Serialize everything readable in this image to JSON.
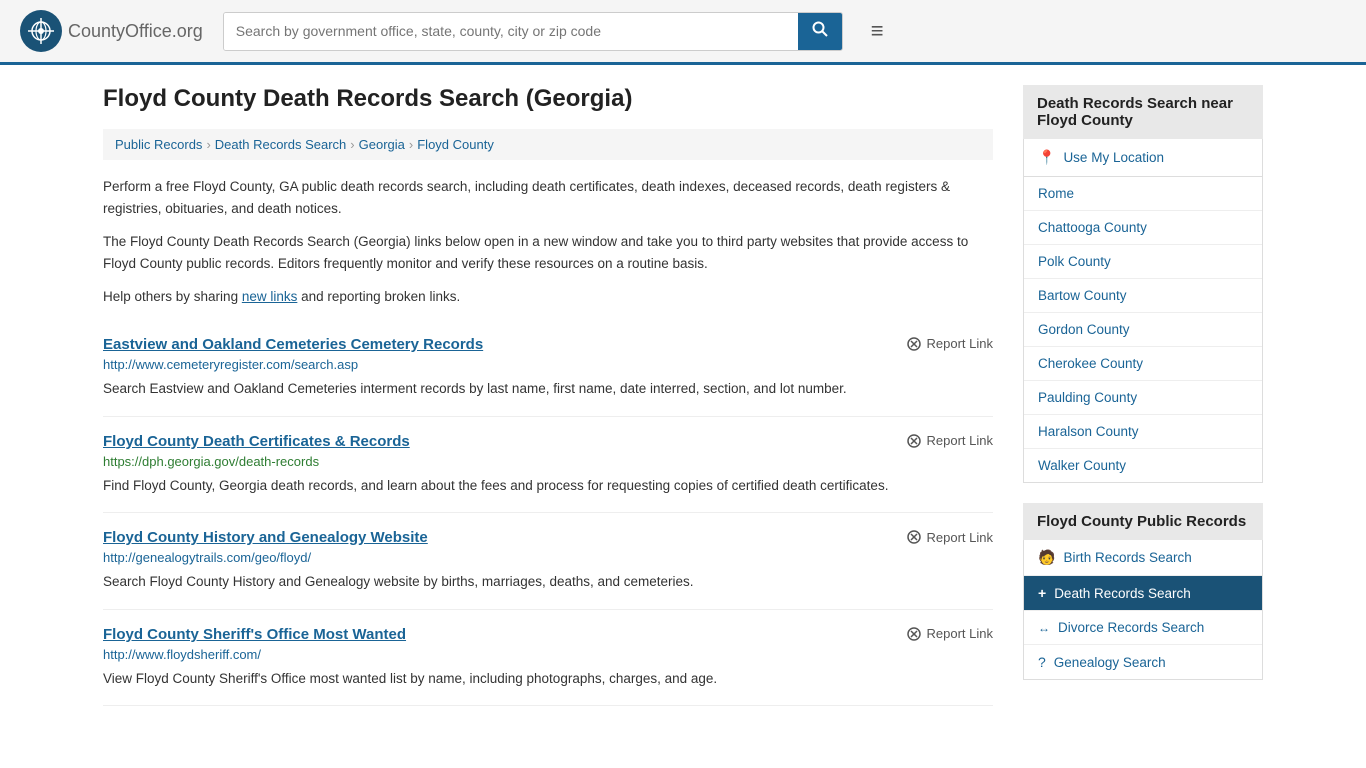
{
  "header": {
    "logo_text": "CountyOffice",
    "logo_suffix": ".org",
    "search_placeholder": "Search by government office, state, county, city or zip code",
    "search_value": ""
  },
  "page": {
    "title": "Floyd County Death Records Search (Georgia)",
    "breadcrumb": [
      {
        "label": "Public Records",
        "href": "#"
      },
      {
        "label": "Death Records Search",
        "href": "#"
      },
      {
        "label": "Georgia",
        "href": "#"
      },
      {
        "label": "Floyd County",
        "href": "#"
      }
    ],
    "desc1": "Perform a free Floyd County, GA public death records search, including death certificates, death indexes, deceased records, death registers & registries, obituaries, and death notices.",
    "desc2": "The Floyd County Death Records Search (Georgia) links below open in a new window and take you to third party websites that provide access to Floyd County public records. Editors frequently monitor and verify these resources on a routine basis.",
    "desc3_before": "Help others by sharing ",
    "desc3_link": "new links",
    "desc3_after": " and reporting broken links."
  },
  "results": [
    {
      "title": "Eastview and Oakland Cemeteries Cemetery Records",
      "url": "http://www.cemeteryregister.com/search.asp",
      "url_color": "blue",
      "desc": "Search Eastview and Oakland Cemeteries interment records by last name, first name, date interred, section, and lot number.",
      "report_label": "Report Link"
    },
    {
      "title": "Floyd County Death Certificates & Records",
      "url": "https://dph.georgia.gov/death-records",
      "url_color": "green",
      "desc": "Find Floyd County, Georgia death records, and learn about the fees and process for requesting copies of certified death certificates.",
      "report_label": "Report Link"
    },
    {
      "title": "Floyd County History and Genealogy Website",
      "url": "http://genealogytrails.com/geo/floyd/",
      "url_color": "blue",
      "desc": "Search Floyd County History and Genealogy website by births, marriages, deaths, and cemeteries.",
      "report_label": "Report Link"
    },
    {
      "title": "Floyd County Sheriff's Office Most Wanted",
      "url": "http://www.floydsheriff.com/",
      "url_color": "blue",
      "desc": "View Floyd County Sheriff's Office most wanted list by name, including photographs, charges, and age.",
      "report_label": "Report Link"
    }
  ],
  "sidebar": {
    "nearby_header": "Death Records Search near Floyd County",
    "use_location": "Use My Location",
    "nearby_items": [
      {
        "label": "Rome",
        "href": "#"
      },
      {
        "label": "Chattooga County",
        "href": "#"
      },
      {
        "label": "Polk County",
        "href": "#"
      },
      {
        "label": "Bartow County",
        "href": "#"
      },
      {
        "label": "Gordon County",
        "href": "#"
      },
      {
        "label": "Cherokee County",
        "href": "#"
      },
      {
        "label": "Paulding County",
        "href": "#"
      },
      {
        "label": "Haralson County",
        "href": "#"
      },
      {
        "label": "Walker County",
        "href": "#"
      }
    ],
    "public_records_header": "Floyd County Public Records",
    "public_records_items": [
      {
        "label": "Birth Records Search",
        "icon": "person",
        "active": false
      },
      {
        "label": "Death Records Search",
        "icon": "plus",
        "active": true
      },
      {
        "label": "Divorce Records Search",
        "icon": "arrows",
        "active": false
      },
      {
        "label": "Genealogy Search",
        "icon": "question",
        "active": false
      }
    ]
  }
}
